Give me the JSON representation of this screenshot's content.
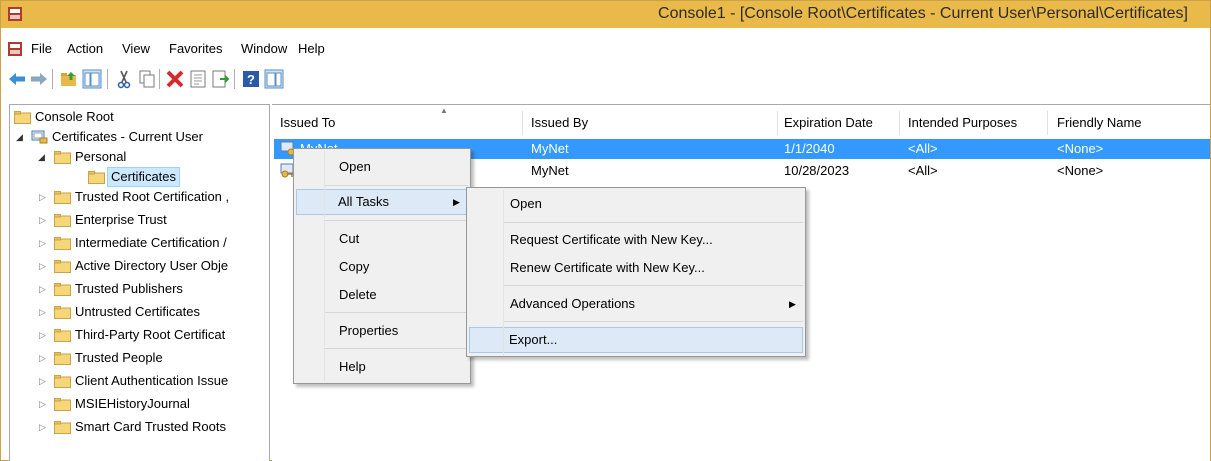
{
  "window": {
    "title": "Console1 - [Console Root\\Certificates - Current User\\Personal\\Certificates]"
  },
  "menubar": {
    "items": [
      "File",
      "Action",
      "View",
      "Favorites",
      "Window",
      "Help"
    ]
  },
  "toolbar": {
    "buttons": [
      "back-arrow-icon",
      "forward-arrow-icon",
      "up-folder-icon",
      "show-hide-tree-icon",
      "cut-icon",
      "copy-icon",
      "delete-icon",
      "properties-icon",
      "export-list-icon",
      "help-icon",
      "show-action-pane-icon"
    ]
  },
  "tree": {
    "root": "Console Root",
    "store": "Certificates - Current User",
    "personal": "Personal",
    "certificates": "Certificates",
    "folders": [
      "Trusted Root Certification ,",
      "Enterprise Trust",
      "Intermediate Certification /",
      "Active Directory User Obje",
      "Trusted Publishers",
      "Untrusted Certificates",
      "Third-Party Root Certificat",
      "Trusted People",
      "Client Authentication Issue",
      "MSIEHistoryJournal",
      "Smart Card Trusted Roots"
    ]
  },
  "list": {
    "columns": [
      "Issued To",
      "Issued By",
      "Expiration Date",
      "Intended Purposes",
      "Friendly Name"
    ],
    "rows": [
      {
        "issued_to": "MyNet",
        "issued_by": "MyNet",
        "expiration": "1/1/2040",
        "purposes": "<All>",
        "friendly": "<None>"
      },
      {
        "issued_to": "",
        "issued_by": "MyNet",
        "expiration": "10/28/2023",
        "purposes": "<All>",
        "friendly": "<None>"
      }
    ]
  },
  "context_menu": {
    "open": "Open",
    "all_tasks": "All Tasks",
    "cut": "Cut",
    "copy": "Copy",
    "delete": "Delete",
    "properties": "Properties",
    "help": "Help"
  },
  "submenu": {
    "open": "Open",
    "request_new_key": "Request Certificate with New Key...",
    "renew_new_key": "Renew Certificate with New Key...",
    "advanced": "Advanced Operations",
    "export": "Export..."
  },
  "colors": {
    "titlebar": "#e9b949",
    "selection": "#3399ff",
    "menu_highlight": "#dde9f7"
  }
}
